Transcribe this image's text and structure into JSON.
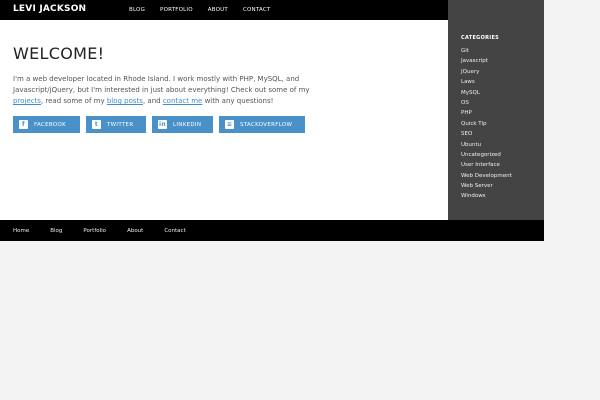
{
  "header": {
    "brand": "LEVI JACKSON",
    "nav": [
      "BLOG",
      "PORTFOLIO",
      "ABOUT",
      "CONTACT"
    ]
  },
  "main": {
    "title": "WELCOME!",
    "intro": {
      "part1": "I'm a web developer located in Rhode Island. I work mostly with PHP, MySQL, and Javascript/jQuery, but I'm interested in just about everything! Check out some of my ",
      "link1": "projects",
      "part2": ", read some of my ",
      "link2": "blog posts",
      "part3": ", and ",
      "link3": "contact me",
      "part4": " with any questions!"
    },
    "social": [
      {
        "label": "FACEBOOK",
        "icon": "facebook-icon",
        "glyph": "f"
      },
      {
        "label": "TWITTER",
        "icon": "twitter-icon",
        "glyph": "t"
      },
      {
        "label": "LINKEDIN",
        "icon": "linkedin-icon",
        "glyph": "in"
      },
      {
        "label": "STACKOVERFLOW",
        "icon": "stackoverflow-icon",
        "glyph": "≡"
      }
    ]
  },
  "sidebar": {
    "heading": "CATEGORIES",
    "items": [
      "Git",
      "Javascript",
      "JQuery",
      "Laws",
      "MySQL",
      "OS",
      "PHP",
      "Quick Tip",
      "SEO",
      "Ubuntu",
      "Uncategorized",
      "User Interface",
      "Web Development",
      "Web Server",
      "Windows"
    ]
  },
  "footer": {
    "nav": [
      "Home",
      "Blog",
      "Portfolio",
      "About",
      "Contact"
    ]
  },
  "colors": {
    "accent": "#4a91c9",
    "link": "#3b8fd1",
    "sidebar_bg": "#444444",
    "bar_bg": "#000000"
  }
}
